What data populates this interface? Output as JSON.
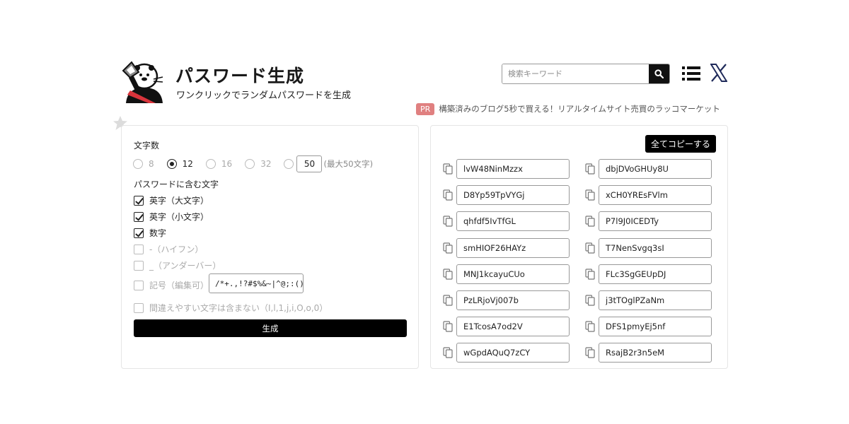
{
  "header": {
    "title": "パスワード生成",
    "subtitle": "ワンクリックでランダムパスワードを生成",
    "search_placeholder": "検索キーワード",
    "logo_icon": "otter-mascot-logo",
    "search_icon": "search-icon",
    "menu_icon": "list-menu-icon",
    "x_icon": "x-logo-icon"
  },
  "pr": {
    "badge": "PR",
    "text": "構築済みのブログ5秒で買える！リアルタイムサイト売買のラッコマーケット"
  },
  "settings": {
    "length_label": "文字数",
    "length_options": [
      "8",
      "12",
      "16",
      "32"
    ],
    "selected_length": "12",
    "custom_length_value": "50",
    "custom_length_hint": "(最大50文字)",
    "include_label": "パスワードに含む文字",
    "options": [
      {
        "label": "英字（大文字）",
        "checked": true
      },
      {
        "label": "英字（小文字）",
        "checked": true
      },
      {
        "label": "数字",
        "checked": true
      },
      {
        "label": "-（ハイフン）",
        "checked": false
      },
      {
        "label": "_（アンダーバー）",
        "checked": false
      },
      {
        "label": "記号（編集可）",
        "checked": false
      },
      {
        "label": "間違えやすい文字は含まない（I,l,1,j,i,O,o,0）",
        "checked": false
      }
    ],
    "symbols_value": "/*+.,!?#$%&~|^@;:()[]{}",
    "generate_label": "生成"
  },
  "results": {
    "copy_all_label": "全てコピーする",
    "passwords": [
      "lvW48NinMzzx",
      "dbjDVoGHUy8U",
      "D8Yp59TpVYGj",
      "xCH0YREsFVlm",
      "qhfdf5IvTfGL",
      "P7l9J0ICEDTy",
      "smHIOF26HAYz",
      "T7NenSvgq3sI",
      "MNJ1kcayuCUo",
      "FLc3SgGEUpDJ",
      "PzLRjoVj007b",
      "j3tTOglPZaNm",
      "E1TcosA7od2V",
      "DFS1pmyEj5nf",
      "wGpdAQuQ7zCY",
      "RsajB2r3n5eM"
    ]
  },
  "colors": {
    "accent": "#000000",
    "pr_badge": "#e08080",
    "border": "#e5e5e5"
  }
}
